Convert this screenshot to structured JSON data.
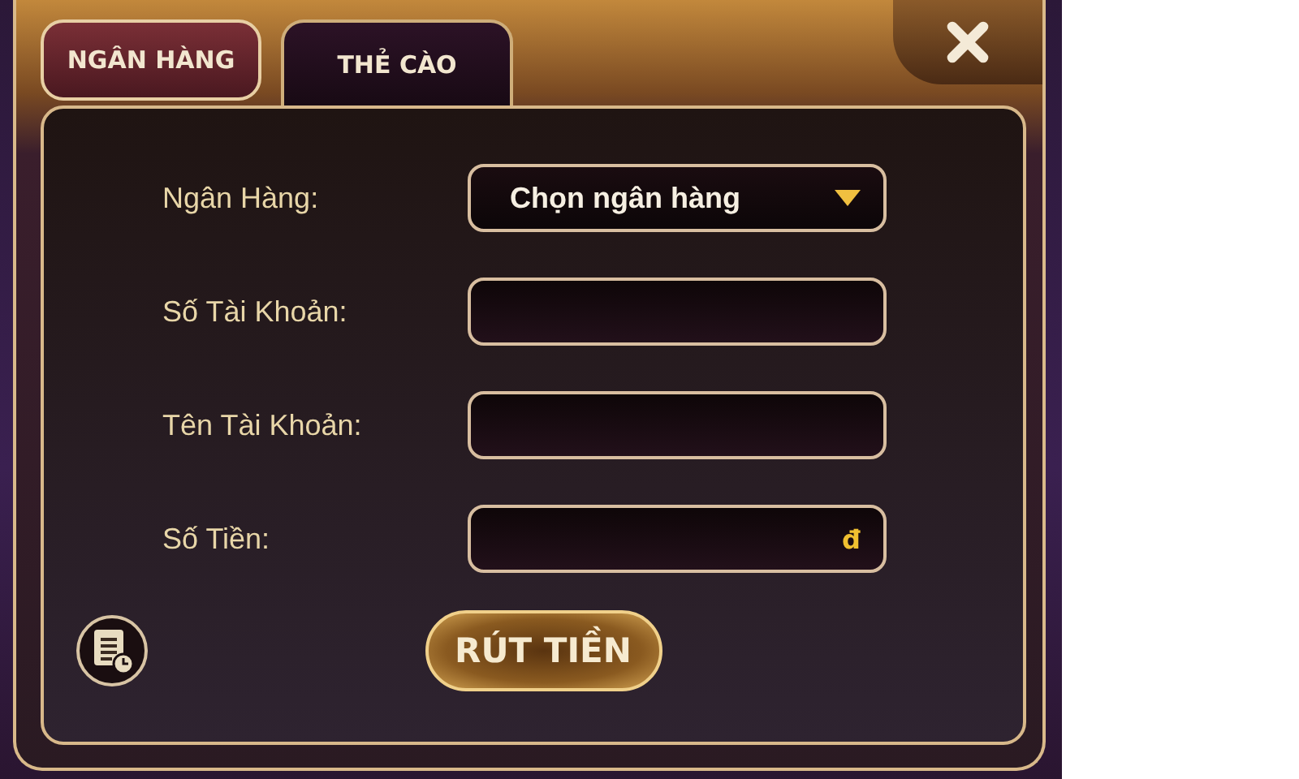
{
  "tabs": [
    {
      "label": "NGÂN HÀNG",
      "selected": true
    },
    {
      "label": "THẺ CÀO",
      "selected": false
    }
  ],
  "form": {
    "fields": [
      {
        "label": "Ngân Hàng:",
        "kind": "select",
        "value": "Chọn ngân hàng"
      },
      {
        "label": "Số Tài Khoản:",
        "kind": "input"
      },
      {
        "label": "Tên Tài Khoản:",
        "kind": "input"
      },
      {
        "label": "Số Tiền:",
        "kind": "input",
        "suffix": "đ"
      }
    ],
    "submit": "RÚT TIỀN"
  }
}
